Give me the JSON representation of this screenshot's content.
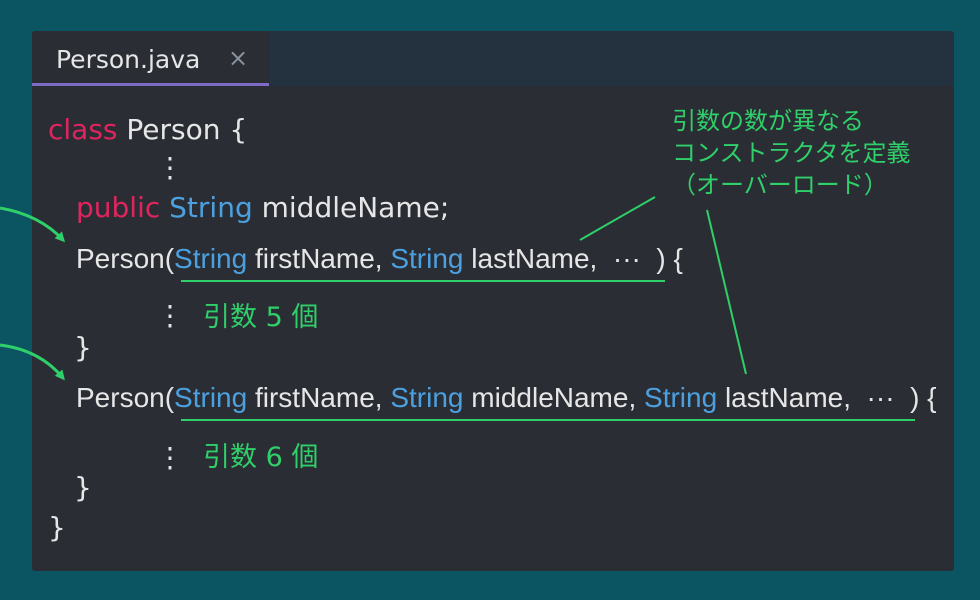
{
  "tab": {
    "title": "Person.java",
    "close": "×"
  },
  "code": {
    "kw_class": "class",
    "class_name": " Person {",
    "dots": "⋮",
    "kw_public": "public",
    "field_type": "String",
    "field_name": " middleName;",
    "ctor1": {
      "name": "Person(",
      "t1": "String",
      "p1": " firstName, ",
      "t2": "String",
      "p2": " lastName,  ···  ) {"
    },
    "ctor2": {
      "name": "Person(",
      "t1": "String",
      "p1": " firstName, ",
      "t2": "String",
      "p2": " middleName, ",
      "t3": "String",
      "p3": " lastName,  ···  ) {"
    },
    "close_brace": "}"
  },
  "annotations": {
    "note_line1": "引数の数が異なる",
    "note_line2": "コンストラクタを定義",
    "note_line3": "（オーバーロード）",
    "args5": "引数 5 個",
    "args6": "引数 6 個"
  },
  "colors": {
    "background": "#0b5563",
    "editor": "#2a2e34",
    "keyword": "#e0245e",
    "type": "#4ca0e0",
    "annotation": "#2fcf6a",
    "tab_accent": "#7e6cc4"
  }
}
